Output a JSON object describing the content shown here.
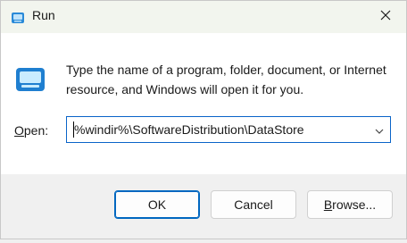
{
  "window": {
    "title": "Run",
    "title_icon": "run-app-icon",
    "close_icon": "close-icon"
  },
  "content": {
    "description": "Type the name of a program, folder, document, or Internet resource, and Windows will open it for you.",
    "open_label_accel": "O",
    "open_label_rest": "pen:",
    "open_value": "%windir%\\SoftwareDistribution\\DataStore",
    "dropdown_icon": "chevron-down-icon"
  },
  "buttons": {
    "ok": "OK",
    "cancel": "Cancel",
    "browse_accel": "B",
    "browse_rest": "rowse..."
  },
  "colors": {
    "accent": "#0067c0",
    "titlebar": "#f2f5ee",
    "footer": "#f0f0f0"
  }
}
